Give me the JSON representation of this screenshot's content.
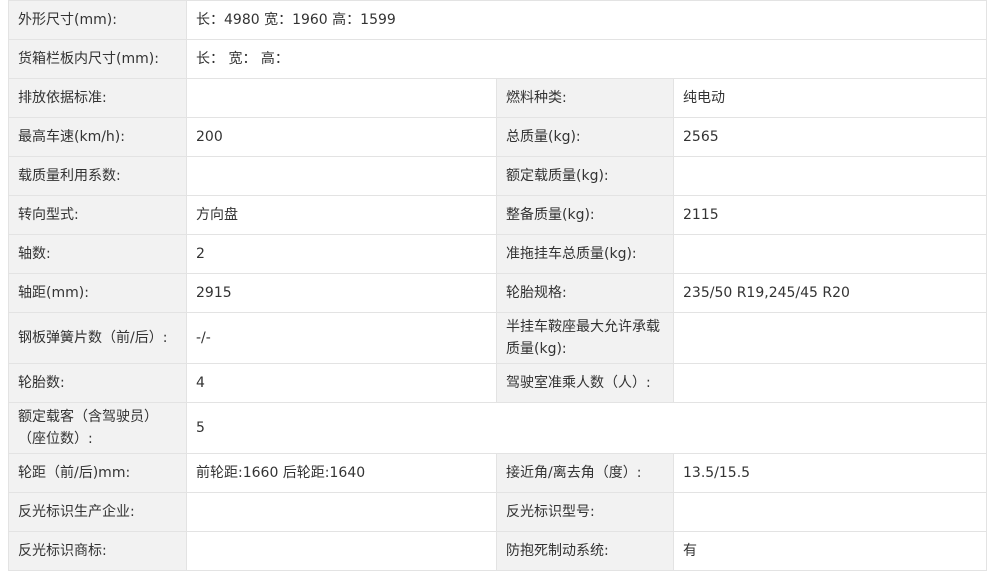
{
  "rows": [
    {
      "k1": "外形尺寸(mm):",
      "v1": "长：4980 宽：1960 高：1599"
    },
    {
      "k1": "货箱栏板内尺寸(mm):",
      "v1": "长： 宽： 高："
    },
    {
      "k1": "排放依据标准:",
      "v1": "",
      "k2": "燃料种类:",
      "v2": "纯电动"
    },
    {
      "k1": "最高车速(km/h):",
      "v1": "200",
      "k2": "总质量(kg):",
      "v2": "2565"
    },
    {
      "k1": "载质量利用系数:",
      "v1": "",
      "k2": "额定载质量(kg):",
      "v2": ""
    },
    {
      "k1": "转向型式:",
      "v1": "方向盘",
      "k2": "整备质量(kg):",
      "v2": "2115"
    },
    {
      "k1": "轴数:",
      "v1": "2",
      "k2": "准拖挂车总质量(kg):",
      "v2": ""
    },
    {
      "k1": "轴距(mm):",
      "v1": "2915",
      "k2": "轮胎规格:",
      "v2": "235/50 R19,245/45 R20"
    },
    {
      "k1": "钢板弹簧片数（前/后）:",
      "v1": "-/-",
      "k2": "半挂车鞍座最大允许承载质量(kg):",
      "v2": ""
    },
    {
      "k1": "轮胎数:",
      "v1": "4",
      "k2": "驾驶室准乘人数（人）:",
      "v2": ""
    },
    {
      "k1": "额定载客（含驾驶员）（座位数）:",
      "v1": "5"
    },
    {
      "k1": "轮距（前/后)mm:",
      "v1": "前轮距:1660 后轮距:1640",
      "k2": "接近角/离去角（度）:",
      "v2": "13.5/15.5"
    },
    {
      "k1": "反光标识生产企业:",
      "v1": "",
      "k2": "反光标识型号:",
      "v2": ""
    },
    {
      "k1": "反光标识商标:",
      "v1": "",
      "k2": "防抱死制动系统:",
      "v2": "有"
    }
  ]
}
